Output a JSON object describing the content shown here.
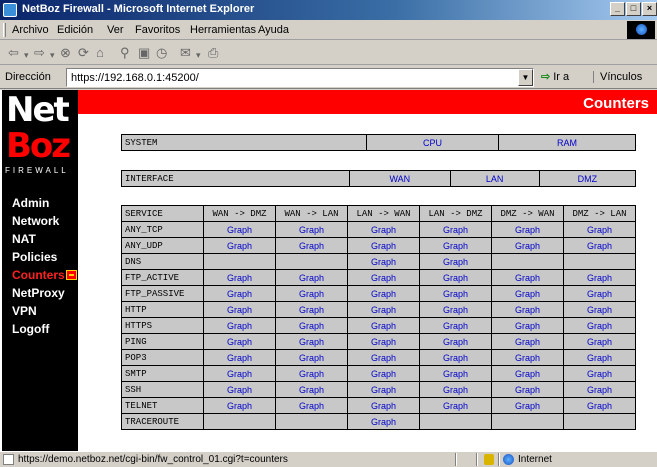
{
  "window": {
    "title": "NetBoz Firewall - Microsoft Internet Explorer"
  },
  "menu": [
    "Archivo",
    "Edición",
    "Ver",
    "Favoritos",
    "Herramientas",
    "Ayuda"
  ],
  "address": {
    "label": "Dirección",
    "url": "https://192.168.0.1:45200/",
    "go": "Ir a",
    "links": "Vínculos"
  },
  "page": {
    "title": "Counters"
  },
  "logo": {
    "line1": "Net",
    "line2": "Boz",
    "tagline": "FIREWALL"
  },
  "nav": [
    {
      "label": "Admin"
    },
    {
      "label": "Network"
    },
    {
      "label": "NAT"
    },
    {
      "label": "Policies"
    },
    {
      "label": "Counters"
    },
    {
      "label": "NetProxy"
    },
    {
      "label": "VPN"
    },
    {
      "label": "Logoff"
    }
  ],
  "system_table": {
    "label": "SYSTEM",
    "cols": [
      "CPU",
      "RAM"
    ]
  },
  "interface_table": {
    "label": "INTERFACE",
    "cols": [
      "WAN",
      "LAN",
      "DMZ"
    ]
  },
  "service_table": {
    "headers": [
      "SERVICE",
      "WAN -> DMZ",
      "WAN -> LAN",
      "LAN -> WAN",
      "LAN -> DMZ",
      "DMZ -> WAN",
      "DMZ -> LAN"
    ],
    "rows": [
      {
        "service": "ANY_TCP",
        "cells": [
          "Graph",
          "Graph",
          "Graph",
          "Graph",
          "Graph",
          "Graph"
        ]
      },
      {
        "service": "ANY_UDP",
        "cells": [
          "Graph",
          "Graph",
          "Graph",
          "Graph",
          "Graph",
          "Graph"
        ]
      },
      {
        "service": "DNS",
        "cells": [
          "",
          "",
          "Graph",
          "Graph",
          "",
          ""
        ]
      },
      {
        "service": "FTP_ACTIVE",
        "cells": [
          "Graph",
          "Graph",
          "Graph",
          "Graph",
          "Graph",
          "Graph"
        ]
      },
      {
        "service": "FTP_PASSIVE",
        "cells": [
          "Graph",
          "Graph",
          "Graph",
          "Graph",
          "Graph",
          "Graph"
        ]
      },
      {
        "service": "HTTP",
        "cells": [
          "Graph",
          "Graph",
          "Graph",
          "Graph",
          "Graph",
          "Graph"
        ]
      },
      {
        "service": "HTTPS",
        "cells": [
          "Graph",
          "Graph",
          "Graph",
          "Graph",
          "Graph",
          "Graph"
        ]
      },
      {
        "service": "PING",
        "cells": [
          "Graph",
          "Graph",
          "Graph",
          "Graph",
          "Graph",
          "Graph"
        ]
      },
      {
        "service": "POP3",
        "cells": [
          "Graph",
          "Graph",
          "Graph",
          "Graph",
          "Graph",
          "Graph"
        ]
      },
      {
        "service": "SMTP",
        "cells": [
          "Graph",
          "Graph",
          "Graph",
          "Graph",
          "Graph",
          "Graph"
        ]
      },
      {
        "service": "SSH",
        "cells": [
          "Graph",
          "Graph",
          "Graph",
          "Graph",
          "Graph",
          "Graph"
        ]
      },
      {
        "service": "TELNET",
        "cells": [
          "Graph",
          "Graph",
          "Graph",
          "Graph",
          "Graph",
          "Graph"
        ]
      },
      {
        "service": "TRACEROUTE",
        "cells": [
          "",
          "",
          "Graph",
          "",
          "",
          ""
        ]
      }
    ]
  },
  "status": {
    "url": "https://demo.netboz.net/cgi-bin/fw_control_01.cgi?t=counters",
    "zone": "Internet"
  },
  "colors": {
    "accent": "#ff0000",
    "link": "#0000cc",
    "cell_bg": "#c8c8c8"
  }
}
